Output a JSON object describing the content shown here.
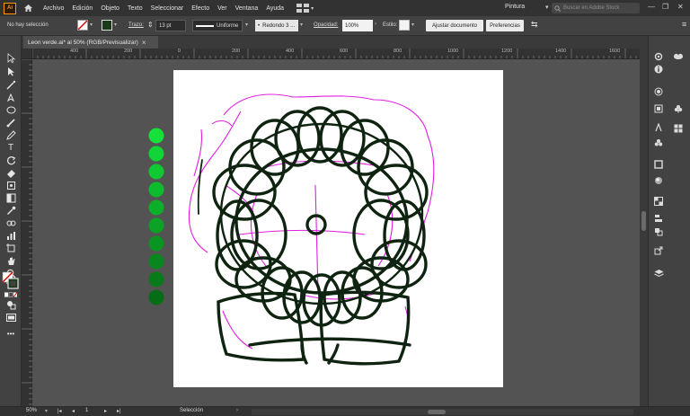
{
  "menubar": {
    "logo": "Ai",
    "items": [
      "Archivo",
      "Edición",
      "Objeto",
      "Texto",
      "Seleccionar",
      "Efecto",
      "Ver",
      "Ventana",
      "Ayuda"
    ],
    "workspace": "Pintura",
    "stock_placeholder": "Buscar en Adobe Stock"
  },
  "control": {
    "selection": "No hay selección",
    "stroke_label": "Trazo:",
    "stroke_weight": "13 pt",
    "profile": "Uniforme",
    "brush": "Redondo 3 ...",
    "opacity_label": "Opacidad:",
    "opacity": "100%",
    "style_label": "Estilo:",
    "adjust_doc": "Ajustar documento",
    "preferences": "Preferencias"
  },
  "document": {
    "tab_title": "Leon verde.ai* al 50% (RGB/Previsualizar)",
    "close": "×"
  },
  "ruler": {
    "labels": [
      "400",
      "200",
      "0",
      "200",
      "400",
      "600",
      "800",
      "1000",
      "1200",
      "1400",
      "1600"
    ]
  },
  "status": {
    "zoom": "50%",
    "artboard": "1",
    "mode": "Selección"
  },
  "colors": {
    "accent": "#ff9a00",
    "stroke_dark": "#0f2410",
    "sketch": "#e020e0",
    "swatches": [
      "#16e03a",
      "#12d436",
      "#10c832",
      "#0fbb2e",
      "#0daf2a",
      "#0ba226",
      "#0a9422",
      "#08871e",
      "#077a1a",
      "#056d16"
    ]
  }
}
